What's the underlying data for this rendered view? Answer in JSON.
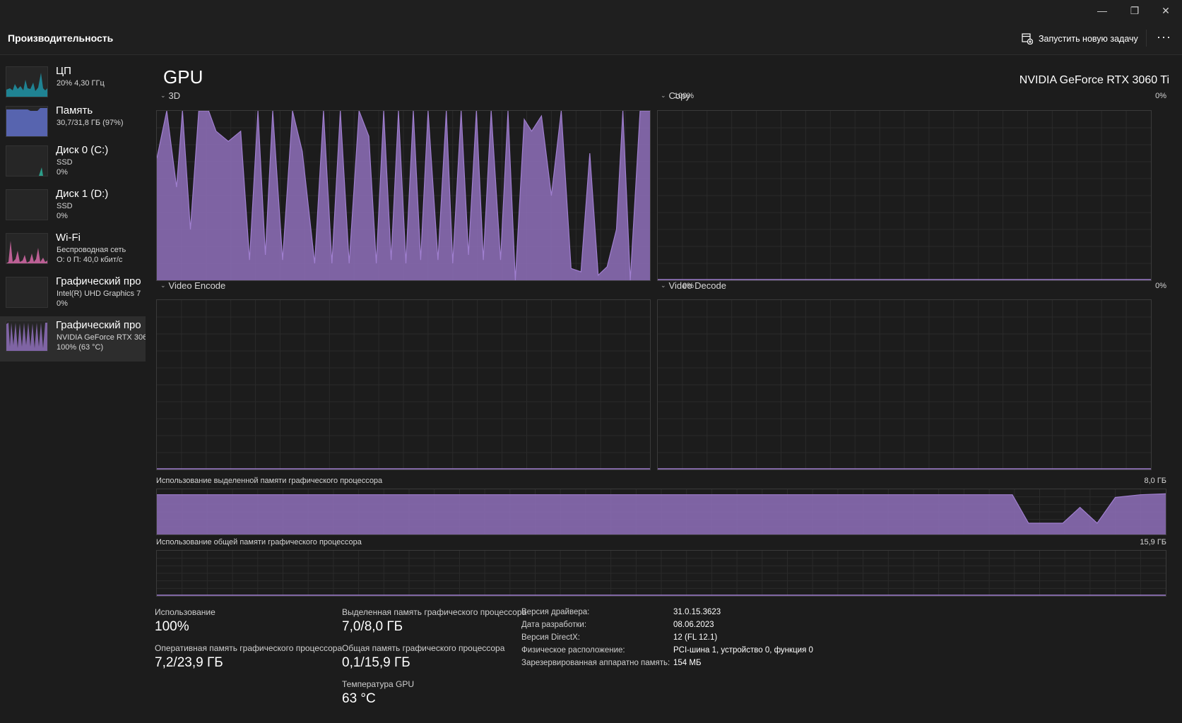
{
  "window": {
    "controls": {
      "minimize": "—",
      "maximize": "❐",
      "close": "✕"
    }
  },
  "header": {
    "title": "Производительность",
    "run_task_label": "Запустить новую задачу",
    "more_label": "···"
  },
  "sidebar": {
    "items": [
      {
        "name": "ЦП",
        "line2": "20% 4,30 ГГц",
        "line3": ""
      },
      {
        "name": "Память",
        "line2": "30,7/31,8 ГБ (97%)",
        "line3": ""
      },
      {
        "name": "Диск 0 (C:)",
        "line2": "SSD",
        "line3": "0%"
      },
      {
        "name": "Диск 1 (D:)",
        "line2": "SSD",
        "line3": "0%"
      },
      {
        "name": "Wi-Fi",
        "line2": "Беспроводная сеть",
        "line3": "О: 0 П: 40,0 кбит/с"
      },
      {
        "name": "Графический про",
        "line2": "Intel(R) UHD Graphics 7",
        "line3": "0%"
      },
      {
        "name": "Графический про",
        "line2": "NVIDIA GeForce RTX 306",
        "line3": "100% (63 °C)"
      }
    ]
  },
  "main": {
    "title": "GPU",
    "device_name": "NVIDIA GeForce RTX 3060 Ti",
    "engines": [
      {
        "label": "3D",
        "pct": "100%"
      },
      {
        "label": "Copy",
        "pct": "0%"
      },
      {
        "label": "Video Encode",
        "pct": "0%"
      },
      {
        "label": "Video Decode",
        "pct": "0%"
      }
    ],
    "dedicated_mem": {
      "label": "Использование выделенной памяти графического процессора",
      "max": "8,0 ГБ"
    },
    "shared_mem": {
      "label": "Использование общей памяти графического процессора",
      "max": "15,9 ГБ"
    }
  },
  "stats": {
    "usage": {
      "label": "Использование",
      "value": "100%"
    },
    "gpu_ram": {
      "label": "Оперативная память графического процессора",
      "value": "7,2/23,9 ГБ"
    },
    "dedicated": {
      "label": "Выделенная память графического процессора",
      "value": "7,0/8,0 ГБ"
    },
    "shared": {
      "label": "Общая память графического процессора",
      "value": "0,1/15,9 ГБ"
    },
    "temp": {
      "label": "Температура GPU",
      "value": "63 °C"
    }
  },
  "info": [
    {
      "label": "Версия драйвера:",
      "value": "31.0.15.3623"
    },
    {
      "label": "Дата разработки:",
      "value": "08.06.2023"
    },
    {
      "label": "Версия DirectX:",
      "value": "12 (FL 12.1)"
    },
    {
      "label": "Физическое расположение:",
      "value": "PCI-шина 1, устройство 0, функция 0"
    },
    {
      "label": "Зарезервированная аппаратно память:",
      "value": "154 МБ"
    }
  ],
  "colors": {
    "gpu_fill": "#8a6cb3",
    "gpu_line": "#a07fd0",
    "cpu": "#1ea3b8",
    "memory": "#6070c8",
    "wifi": "#d66aa8"
  }
}
